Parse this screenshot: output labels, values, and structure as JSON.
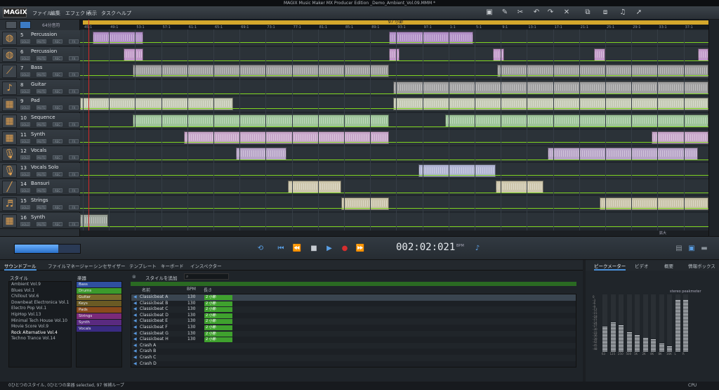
{
  "window_title": "MAGIX Music Maker MX Producer Edition   _Demo_Ambient_Vol.09.MMM *",
  "logo": "MAGIX",
  "menu": [
    "ファイル",
    "編集",
    "エフェクト",
    "表示",
    "タスク",
    "ヘルプ"
  ],
  "zoom_label": "64分音符",
  "loop_label": "97 小節",
  "ruler": [
    "45:1",
    "49:1",
    "53:1",
    "57:1",
    "61:1",
    "65:1",
    "69:1",
    "73:1",
    "77:1",
    "81:1",
    "85:1",
    "89:1",
    "93:1",
    "97:1",
    "1:1",
    "5:1",
    "9:1",
    "13:1",
    "17:1",
    "21:1",
    "25:1",
    "29:1",
    "33:1",
    "37:1"
  ],
  "tracks": [
    {
      "num": "5",
      "name": "Percussion",
      "icon": "conga-icon",
      "color": "#b08fc6"
    },
    {
      "num": "6",
      "name": "Percussion",
      "icon": "conga-icon",
      "color": "#c29ac9"
    },
    {
      "num": "7",
      "name": "Bass",
      "icon": "bass-icon",
      "color": "#9c9c9c"
    },
    {
      "num": "8",
      "name": "Guitar",
      "icon": "guitar-icon",
      "color": "#a0a0a0"
    },
    {
      "num": "9",
      "name": "Pad",
      "icon": "synth-icon",
      "color": "#c4c9b4"
    },
    {
      "num": "10",
      "name": "Sequence",
      "icon": "synth-icon",
      "color": "#9ec49a"
    },
    {
      "num": "11",
      "name": "Synth",
      "icon": "synth-icon",
      "color": "#c7a6c9"
    },
    {
      "num": "12",
      "name": "Vocals",
      "icon": "microphone-icon",
      "color": "#b8a5c8"
    },
    {
      "num": "13",
      "name": "Vocals Solo",
      "icon": "microphone-icon",
      "color": "#b0b4d2"
    },
    {
      "num": "14",
      "name": "Bansuri",
      "icon": "flute-icon",
      "color": "#cdc6ac"
    },
    {
      "num": "15",
      "name": "Strings",
      "icon": "violin-icon",
      "color": "#c9c3a9"
    },
    {
      "num": "16",
      "name": "Synth",
      "icon": "synth-icon",
      "color": "#9aa39a"
    }
  ],
  "track_buttons": [
    "SOLO",
    "MUTE",
    "REC",
    "FX"
  ],
  "zoom_controls": "拡大",
  "time": "002:02:021",
  "bpm_label": "BPM",
  "tabs": [
    "サウンドプール",
    "ファイルマネージャー",
    "シンセサイザー",
    "テンプレート",
    "キーボード",
    "インスペクター"
  ],
  "right_tabs": [
    "ピークメーター",
    "ビデオ",
    "概要",
    "情報ボックス"
  ],
  "pool": {
    "style_header": "スタイル",
    "inst_header": "楽器",
    "add_style": "スタイルを追加",
    "styles": [
      "Ambient Vol.9",
      "Blues Vol.1",
      "Chillout Vol.6",
      "Downbeat Electronica Vol.1",
      "Electro Pop Vol.1",
      "HipHop Vol.13",
      "Minimal Tech House Vol.10",
      "Movie Score Vol.9",
      "Rock Alternative Vol.4",
      "Techno Trance Vol.14"
    ],
    "instruments": [
      {
        "n": "Bass",
        "c": "#2f4fa0"
      },
      {
        "n": "Drums",
        "c": "#3c9a2c"
      },
      {
        "n": "Guitar",
        "c": "#7a6a2a"
      },
      {
        "n": "Keys",
        "c": "#6a5a24"
      },
      {
        "n": "Pads",
        "c": "#8a4a1c"
      },
      {
        "n": "Strings",
        "c": "#7a2a7a"
      },
      {
        "n": "Synth",
        "c": "#5a2a80"
      },
      {
        "n": "Vocals",
        "c": "#3a2a82"
      }
    ],
    "cols": [
      "名前",
      "BPM",
      "長さ"
    ],
    "loops": [
      {
        "name": "Classicbeat A",
        "bpm": "130",
        "len": "2 小節"
      },
      {
        "name": "Classicbeat B",
        "bpm": "130",
        "len": "2 小節"
      },
      {
        "name": "Classicbeat C",
        "bpm": "130",
        "len": "2 小節"
      },
      {
        "name": "Classicbeat D",
        "bpm": "130",
        "len": "2 小節"
      },
      {
        "name": "Classicbeat E",
        "bpm": "130",
        "len": "2 小節"
      },
      {
        "name": "Classicbeat F",
        "bpm": "130",
        "len": "2 小節"
      },
      {
        "name": "Classicbeat G",
        "bpm": "130",
        "len": "2 小節"
      },
      {
        "name": "Classicbeat H",
        "bpm": "130",
        "len": "2 小節"
      },
      {
        "name": "Crash A",
        "bpm": "",
        "len": ""
      },
      {
        "name": "Crash B",
        "bpm": "",
        "len": ""
      },
      {
        "name": "Crash C",
        "bpm": "",
        "len": ""
      },
      {
        "name": "Crash D",
        "bpm": "",
        "len": ""
      }
    ],
    "status": "0ひとつのスタイル, 0ひとつの楽器 selected, 97 候補ループ"
  },
  "meter": {
    "title": "stereo peakmeter",
    "scale": [
      "0",
      "-3",
      "-6",
      "-9",
      "-12",
      "-15",
      "-18",
      "-21",
      "-24",
      "-27",
      "-30",
      "-33",
      "-36",
      "-39",
      "-42",
      "-45",
      "-48"
    ],
    "bands": [
      "63",
      "125",
      "250",
      "500",
      "1K",
      "2K",
      "4K",
      "8K",
      "16K",
      "L",
      "R"
    ]
  },
  "cpu": "CPU"
}
